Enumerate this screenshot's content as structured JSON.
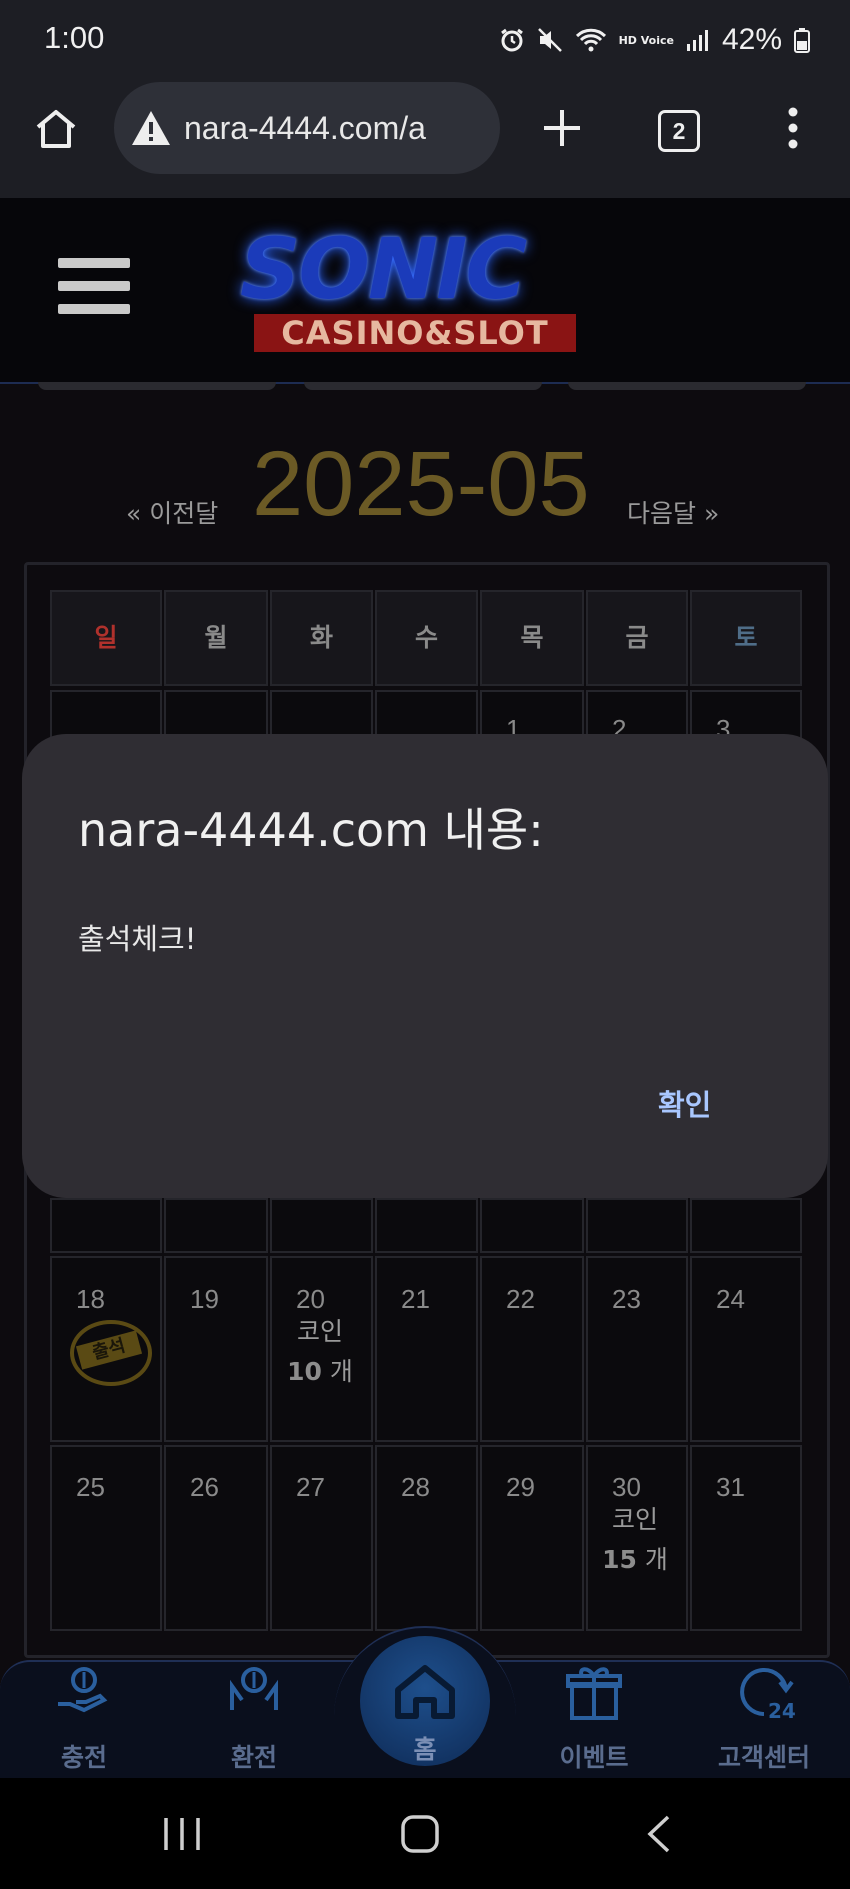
{
  "status_bar": {
    "time": "1:00",
    "battery": "42%",
    "hd_voice": "HD Voice"
  },
  "browser": {
    "url": "nara-4444.com/a",
    "tab_count": "2"
  },
  "site": {
    "logo_main": "SONIC",
    "logo_sub": "CASINO&SLOT"
  },
  "calendar": {
    "prev_label": "« 이전달",
    "month": "2025-05",
    "next_label": "다음달 »",
    "weekdays": [
      "일",
      "월",
      "화",
      "수",
      "목",
      "금",
      "토"
    ],
    "weekday_colors": [
      "#b0312c",
      "#8a8a8a",
      "#8a8a8a",
      "#8a8a8a",
      "#8a8a8a",
      "#8a8a8a",
      "#4f6d88"
    ],
    "visible_days": [
      "1",
      "2",
      "3",
      "18",
      "19",
      "20",
      "21",
      "22",
      "23",
      "24",
      "25",
      "26",
      "27",
      "28",
      "29",
      "30",
      "31"
    ],
    "stamp_label": "출석",
    "coin_label": "코인",
    "coin_20": "10",
    "coin_30": "15",
    "coin_unit": "개"
  },
  "dialog": {
    "title": "nara-4444.com 내용:",
    "message": "출석체크!",
    "ok": "확인"
  },
  "bottom_nav": {
    "charge": "충전",
    "exchange": "환전",
    "home": "홈",
    "event": "이벤트",
    "support": "고객센터"
  },
  "colors": {
    "accent_blue": "#a9c7ff",
    "month_gold": "#6b5a25",
    "nav_icon": "#2a5f9e"
  }
}
